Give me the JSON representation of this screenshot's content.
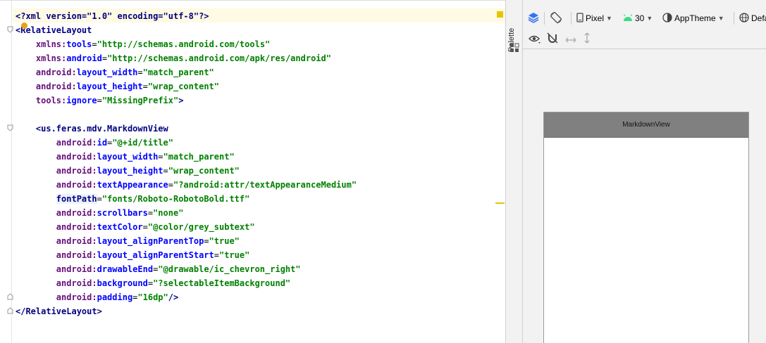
{
  "editor": {
    "lines": [
      [
        [
          "pi",
          "<?xml version=\"1.0\" encoding=\"utf-8\"?>"
        ]
      ],
      [
        [
          "tag",
          "<RelativeLayout"
        ]
      ],
      [
        [
          "pl",
          "    "
        ],
        [
          "ns",
          "xmlns:"
        ],
        [
          "an",
          "tools"
        ],
        [
          "pl",
          "="
        ],
        [
          "av",
          "\"http://schemas.android.com/tools\""
        ]
      ],
      [
        [
          "pl",
          "    "
        ],
        [
          "ns",
          "xmlns:"
        ],
        [
          "an",
          "android"
        ],
        [
          "pl",
          "="
        ],
        [
          "av",
          "\"http://schemas.android.com/apk/res/android\""
        ]
      ],
      [
        [
          "pl",
          "    "
        ],
        [
          "ns",
          "android:"
        ],
        [
          "an",
          "layout_width"
        ],
        [
          "pl",
          "="
        ],
        [
          "av",
          "\"match_parent\""
        ]
      ],
      [
        [
          "pl",
          "    "
        ],
        [
          "ns",
          "android:"
        ],
        [
          "an",
          "layout_height"
        ],
        [
          "pl",
          "="
        ],
        [
          "av",
          "\"wrap_content\""
        ]
      ],
      [
        [
          "pl",
          "    "
        ],
        [
          "ns",
          "tools:"
        ],
        [
          "an",
          "ignore"
        ],
        [
          "pl",
          "="
        ],
        [
          "av",
          "\"MissingPrefix\""
        ],
        [
          "tag",
          ">"
        ]
      ],
      [
        [
          "pl",
          ""
        ]
      ],
      [
        [
          "pl",
          "    "
        ],
        [
          "tag",
          "<us.feras.mdv.MarkdownView"
        ]
      ],
      [
        [
          "pl",
          "        "
        ],
        [
          "ns",
          "android:"
        ],
        [
          "an",
          "id"
        ],
        [
          "pl",
          "="
        ],
        [
          "av",
          "\"@+id/title\""
        ]
      ],
      [
        [
          "pl",
          "        "
        ],
        [
          "ns",
          "android:"
        ],
        [
          "an",
          "layout_width"
        ],
        [
          "pl",
          "="
        ],
        [
          "av",
          "\"match_parent\""
        ]
      ],
      [
        [
          "pl",
          "        "
        ],
        [
          "ns",
          "android:"
        ],
        [
          "an",
          "layout_height"
        ],
        [
          "pl",
          "="
        ],
        [
          "av",
          "\"wrap_content\""
        ]
      ],
      [
        [
          "pl",
          "        "
        ],
        [
          "ns",
          "android:"
        ],
        [
          "an",
          "textAppearance"
        ],
        [
          "pl",
          "="
        ],
        [
          "av",
          "\"?android:attr/textAppearanceMedium\""
        ]
      ],
      [
        [
          "pl",
          "        "
        ],
        [
          "fp",
          "fontPath"
        ],
        [
          "pl",
          "="
        ],
        [
          "av",
          "\"fonts/Roboto-RobotoBold.ttf\""
        ]
      ],
      [
        [
          "pl",
          "        "
        ],
        [
          "ns",
          "android:"
        ],
        [
          "an",
          "scrollbars"
        ],
        [
          "pl",
          "="
        ],
        [
          "av",
          "\"none\""
        ]
      ],
      [
        [
          "pl",
          "        "
        ],
        [
          "ns",
          "android:"
        ],
        [
          "an",
          "textColor"
        ],
        [
          "pl",
          "="
        ],
        [
          "av",
          "\"@color/grey_subtext\""
        ]
      ],
      [
        [
          "pl",
          "        "
        ],
        [
          "ns",
          "android:"
        ],
        [
          "an",
          "layout_alignParentTop"
        ],
        [
          "pl",
          "="
        ],
        [
          "av",
          "\"true\""
        ]
      ],
      [
        [
          "pl",
          "        "
        ],
        [
          "ns",
          "android:"
        ],
        [
          "an",
          "layout_alignParentStart"
        ],
        [
          "pl",
          "="
        ],
        [
          "av",
          "\"true\""
        ]
      ],
      [
        [
          "pl",
          "        "
        ],
        [
          "ns",
          "android:"
        ],
        [
          "an",
          "drawableEnd"
        ],
        [
          "pl",
          "="
        ],
        [
          "av",
          "\"@drawable/ic_chevron_right\""
        ]
      ],
      [
        [
          "pl",
          "        "
        ],
        [
          "ns",
          "android:"
        ],
        [
          "an",
          "background"
        ],
        [
          "pl",
          "="
        ],
        [
          "av",
          "\"?selectableItemBackground\""
        ]
      ],
      [
        [
          "pl",
          "        "
        ],
        [
          "ns",
          "android:"
        ],
        [
          "an",
          "padding"
        ],
        [
          "pl",
          "="
        ],
        [
          "av",
          "\"16dp\""
        ],
        [
          "tag",
          "/>"
        ]
      ],
      [
        [
          "tag",
          "</RelativeLayout>"
        ]
      ]
    ]
  },
  "palette": {
    "label": "Palette",
    "icon": "palette-grid-icon"
  },
  "design_toolbar": {
    "layers_icon": "layers-icon",
    "orientation_icon": "rotate-orientation-icon",
    "device_label": "Pixel",
    "device_icon": "phone-icon",
    "api_label": "30",
    "api_icon": "android-icon",
    "theme_label": "AppTheme",
    "theme_icon": "theme-icon",
    "locale_label": "Defa",
    "locale_icon": "globe-icon"
  },
  "design_toolbar2": {
    "eye_icon": "eye-icon",
    "magnet_icon": "magnet-off-icon",
    "h_arrow_icon": "horizontal-arrows-icon",
    "v_arrow_icon": "vertical-arrows-icon"
  },
  "preview": {
    "component_label": "MarkdownView"
  },
  "colors": {
    "caret_line": "#fffae3",
    "warning": "#e8c400",
    "preview_component_bg": "#808080",
    "android_green": "#3ddc84",
    "icon_blue": "#3574f0"
  }
}
